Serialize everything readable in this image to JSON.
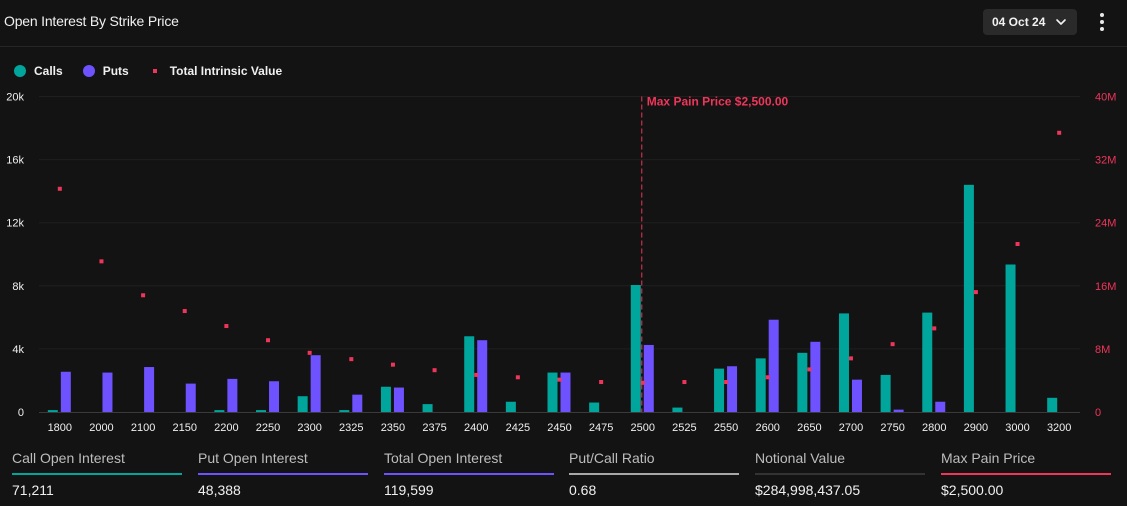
{
  "header": {
    "title": "Open Interest By Strike Price",
    "date_selected": "04 Oct 24",
    "chevron_icon": "chevron-down-icon",
    "more_icon": "more-vertical-icon"
  },
  "colors": {
    "calls": "#00a69c",
    "puts": "#6e52ff",
    "intrinsic": "#f0355a",
    "max_pain": "#f0355a",
    "ratio": "#a8a8a8",
    "notional": "#333333"
  },
  "legend": [
    {
      "label": "Calls",
      "shape": "circle",
      "color": "#00a69c"
    },
    {
      "label": "Puts",
      "shape": "circle",
      "color": "#6e52ff"
    },
    {
      "label": "Total Intrinsic Value",
      "shape": "square",
      "color": "#f0355a"
    }
  ],
  "chart_data": {
    "type": "bar",
    "title": "Open Interest By Strike Price",
    "xlabel": "",
    "ylabel": "",
    "categories": [
      "1800",
      "2000",
      "2100",
      "2150",
      "2200",
      "2250",
      "2300",
      "2325",
      "2350",
      "2375",
      "2400",
      "2425",
      "2450",
      "2475",
      "2500",
      "2525",
      "2550",
      "2600",
      "2650",
      "2700",
      "2750",
      "2800",
      "2900",
      "3000",
      "3200"
    ],
    "series": [
      {
        "name": "Calls",
        "type": "bar",
        "axis": "left",
        "values": [
          120,
          0,
          0,
          0,
          120,
          120,
          1000,
          120,
          1600,
          500,
          4800,
          650,
          2500,
          600,
          8050,
          280,
          2750,
          3400,
          3750,
          6250,
          2350,
          6300,
          14400,
          9350,
          900
        ]
      },
      {
        "name": "Puts",
        "type": "bar",
        "axis": "left",
        "values": [
          2550,
          2500,
          2850,
          1800,
          2100,
          1950,
          3600,
          1100,
          1550,
          0,
          4550,
          0,
          2500,
          0,
          4250,
          0,
          2900,
          5850,
          4450,
          2050,
          150,
          650,
          0,
          0,
          0
        ]
      },
      {
        "name": "Total Intrinsic Value",
        "type": "scatter",
        "axis": "right",
        "values": [
          28300000,
          19100000,
          14800000,
          12800000,
          10900000,
          9100000,
          7500000,
          6700000,
          6000000,
          5300000,
          4700000,
          4400000,
          4100000,
          3800000,
          3700000,
          3800000,
          3800000,
          4400000,
          5400000,
          6800000,
          8600000,
          10600000,
          15200000,
          21300000,
          35400000
        ]
      }
    ],
    "y_left": {
      "range": [
        0,
        20000
      ],
      "ticks": [
        "0",
        "4k",
        "8k",
        "12k",
        "16k",
        "20k"
      ],
      "tick_values": [
        0,
        4000,
        8000,
        12000,
        16000,
        20000
      ]
    },
    "y_right": {
      "range": [
        0,
        40000000
      ],
      "ticks": [
        "0",
        "8M",
        "16M",
        "24M",
        "32M",
        "40M"
      ],
      "tick_values": [
        0,
        8000000,
        16000000,
        24000000,
        32000000,
        40000000
      ]
    },
    "grid": true,
    "legend_position": "top-left",
    "annotations": [
      {
        "type": "vertical-dashed-line",
        "x": "2500",
        "label": "Max Pain Price $2,500.00"
      }
    ]
  },
  "stats": [
    {
      "label": "Call Open Interest",
      "value": "71,211",
      "color": "#00a69c"
    },
    {
      "label": "Put Open Interest",
      "value": "48,388",
      "color": "#6e52ff"
    },
    {
      "label": "Total Open Interest",
      "value": "119,599",
      "color": "#6e52ff"
    },
    {
      "label": "Put/Call Ratio",
      "value": "0.68",
      "color": "#a8a8a8"
    },
    {
      "label": "Notional Value",
      "value": "$284,998,437.05",
      "color": "#333333"
    },
    {
      "label": "Max Pain Price",
      "value": "$2,500.00",
      "color": "#f0355a"
    }
  ]
}
